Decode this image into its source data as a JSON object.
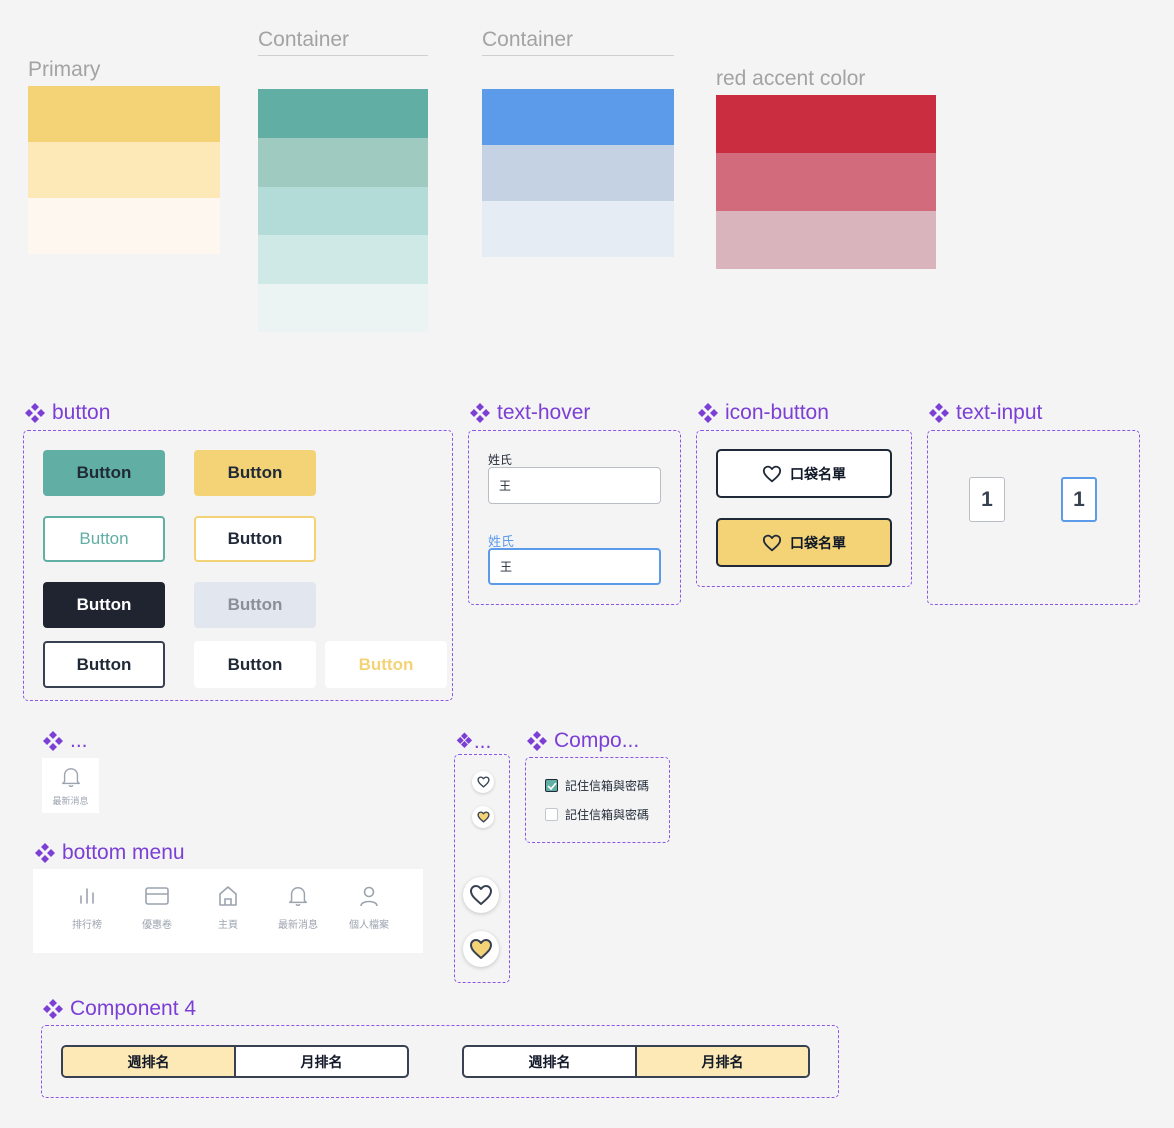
{
  "palettes": [
    {
      "title": "Primary",
      "colors": [
        "#f3d376",
        "#fde9b8",
        "#fef7f0"
      ]
    },
    {
      "title": "Container",
      "colors": [
        "#61aea5",
        "#9fcac0",
        "#b3dbd7",
        "#cfe9e6",
        "#ebf4f3"
      ]
    },
    {
      "title": "Container",
      "colors": [
        "#5b9bea",
        "#c4d2e3",
        "#e5ecf3"
      ]
    },
    {
      "title": "red accent color",
      "colors": [
        "#c92d3f",
        "#d26b7c",
        "#d9b4bc"
      ]
    }
  ],
  "components": {
    "button": {
      "title": "button",
      "labels": [
        "Button",
        "Button",
        "Button",
        "Button",
        "Button",
        "Button",
        "Button",
        "Button",
        "Button"
      ]
    },
    "text_hover": {
      "title": "text-hover",
      "field1_label": "姓氏",
      "field1_value": "王",
      "field2_label": "姓氏",
      "field2_value": "王"
    },
    "icon_button": {
      "title": "icon-button",
      "label1": "口袋名單",
      "label2": "口袋名單"
    },
    "text_input": {
      "title": "text-input",
      "value1": "1",
      "value2": "1"
    },
    "notification": {
      "title": "...",
      "label": "最新消息"
    },
    "hearts": {
      "title": "❖..."
    },
    "checkbox": {
      "title": "Compo...",
      "item1": "記住信箱與密碼",
      "item2": "記住信箱與密碼",
      "item1_checked": true,
      "item2_checked": false
    },
    "bottom_menu": {
      "title": "bottom menu",
      "items": [
        {
          "label": "排行榜",
          "icon": "bar-chart-icon"
        },
        {
          "label": "優惠卷",
          "icon": "credit-card-icon"
        },
        {
          "label": "主頁",
          "icon": "home-icon"
        },
        {
          "label": "最新消息",
          "icon": "bell-icon"
        },
        {
          "label": "個人檔案",
          "icon": "user-icon"
        }
      ]
    },
    "component4": {
      "title": "Component 4",
      "seg1": [
        "週排名",
        "月排名"
      ],
      "seg2": [
        "週排名",
        "月排名"
      ]
    }
  },
  "colors": {
    "accent_purple": "#7b3fd6",
    "primary": "#f3d376",
    "teal": "#61aea5",
    "blue": "#5b9bea",
    "dark": "#1f2937"
  }
}
